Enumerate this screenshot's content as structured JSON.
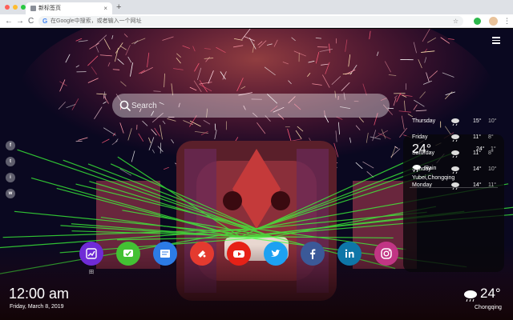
{
  "browser": {
    "tab_title": "新标签页",
    "tab_close": "×",
    "new_tab": "+",
    "back": "←",
    "forward": "→",
    "reload": "C",
    "omnibox_g": "G",
    "omnibox_placeholder": "在Google中搜索，或者输入一个网址",
    "star": "☆",
    "kebab": "⋮",
    "traffic_lights": [
      "#ff5f57",
      "#febc2e",
      "#28c840"
    ]
  },
  "search": {
    "placeholder": "Search"
  },
  "social": [
    "f",
    "t",
    "i",
    "w"
  ],
  "apps": [
    {
      "icon": "stock-chart-icon",
      "color": "#6f2bd6",
      "label": "田"
    },
    {
      "icon": "check-chat-icon",
      "color": "#43c133",
      "label": ""
    },
    {
      "icon": "news-icon",
      "color": "#2c7be5",
      "label": ""
    },
    {
      "icon": "game-controller-icon",
      "color": "#e43a2f",
      "label": ""
    },
    {
      "icon": "youtube-icon",
      "color": "#e62117",
      "label": ""
    },
    {
      "icon": "twitter-icon",
      "color": "#1da1f2",
      "label": ""
    },
    {
      "icon": "facebook-icon",
      "color": "#3b5998",
      "label": ""
    },
    {
      "icon": "linkedin-icon",
      "color": "#0e76a8",
      "label": ""
    },
    {
      "icon": "instagram-icon",
      "color": "#c13584",
      "label": ""
    }
  ],
  "clock": {
    "time": "12:00 am",
    "date": "Friday, March 8, 2019"
  },
  "weather_panel": {
    "temp": "24°",
    "hi": "24°",
    "lo": "1°",
    "condition": "Rain",
    "location": "Yubei,Chongqing",
    "forecast": [
      {
        "day": "Thursday",
        "hi": "15°",
        "lo": "10°"
      },
      {
        "day": "Friday",
        "hi": "11°",
        "lo": "8°"
      },
      {
        "day": "Saturday",
        "hi": "11°",
        "lo": "8°"
      },
      {
        "day": "Sunday",
        "hi": "14°",
        "lo": "10°"
      },
      {
        "day": "Monday",
        "hi": "14°",
        "lo": "11°"
      }
    ]
  },
  "weather_bottom": {
    "temp": "24°",
    "city": "Chongqing"
  }
}
